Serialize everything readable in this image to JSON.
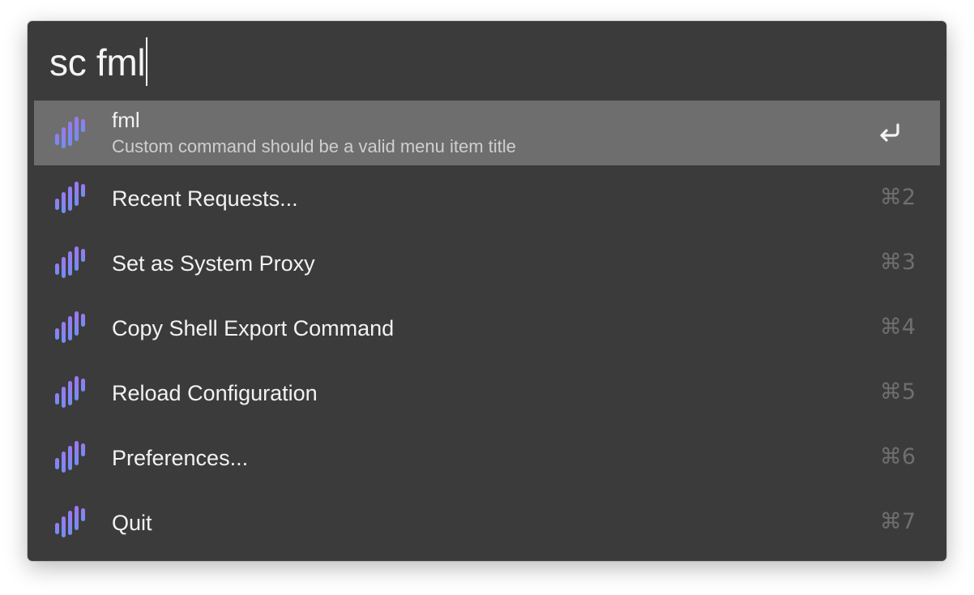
{
  "query": {
    "text": "sc fml"
  },
  "results": [
    {
      "title": "fml",
      "subtitle": "Custom command should be a valid menu item title",
      "shortcut": "",
      "selected": true,
      "action_icon": "return-icon"
    },
    {
      "title": "Recent Requests...",
      "shortcut": "⌘2"
    },
    {
      "title": "Set as System Proxy",
      "shortcut": "⌘3"
    },
    {
      "title": "Copy Shell Export Command",
      "shortcut": "⌘4"
    },
    {
      "title": "Reload Configuration",
      "shortcut": "⌘5"
    },
    {
      "title": "Preferences...",
      "shortcut": "⌘6"
    },
    {
      "title": "Quit",
      "shortcut": "⌘7"
    }
  ],
  "icons": {
    "app": "surge-waveform-icon",
    "action": "return-icon"
  },
  "colors": {
    "panel_background": "#3b3b3b",
    "selected_row": "#6e6e6e",
    "icon_gradient_start": "#5b9bf0",
    "icon_gradient_end": "#b36cf0",
    "shortcut_text": "#6f6f6f"
  }
}
